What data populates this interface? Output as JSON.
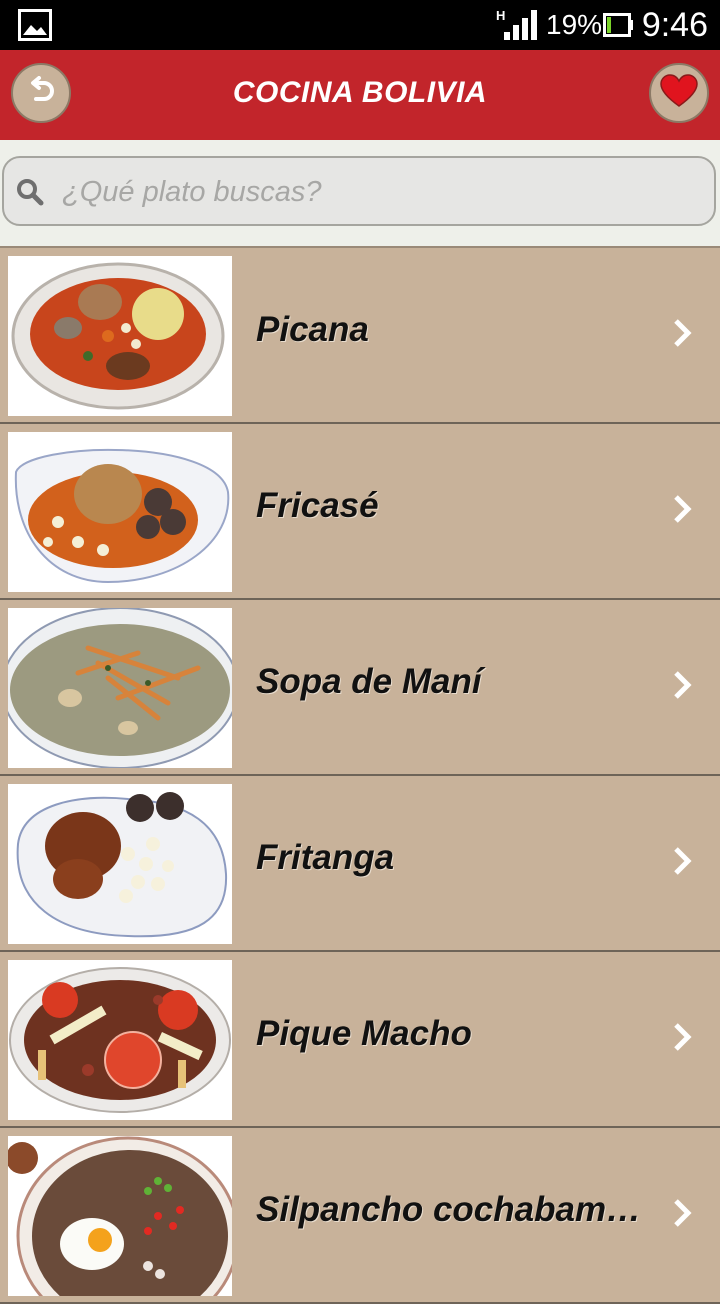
{
  "status_bar": {
    "network": "H",
    "battery": "19%",
    "time": "9:46"
  },
  "header": {
    "title": "COCINA BOLIVIA",
    "back_icon": "undo-arrow-icon",
    "favorite_icon": "heart-icon"
  },
  "search": {
    "placeholder": "¿Qué plato buscas?",
    "value": ""
  },
  "dishes": [
    {
      "name": "Picana"
    },
    {
      "name": "Fricasé"
    },
    {
      "name": "Sopa de Maní"
    },
    {
      "name": "Fritanga"
    },
    {
      "name": "Pique Macho"
    },
    {
      "name": "Silpancho cochabamb..."
    }
  ],
  "colors": {
    "header": "#c2252b",
    "list_background": "#c8b29a",
    "heart": "#e0141e"
  }
}
